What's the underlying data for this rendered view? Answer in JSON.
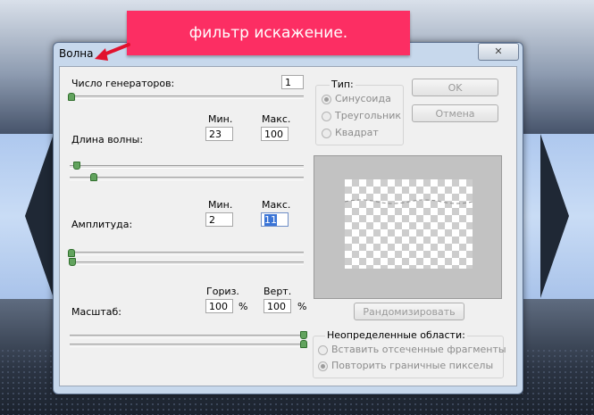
{
  "annotation": {
    "text": "фильтр искажение."
  },
  "dialog": {
    "title": "Волна",
    "close_label": "✕"
  },
  "generators": {
    "label": "Число генераторов:",
    "value": "1",
    "slider_fraction": 0.0
  },
  "wavelength": {
    "label": "Длина волны:",
    "min_label": "Мин.",
    "max_label": "Макс.",
    "min_value": "23",
    "max_value": "100"
  },
  "amplitude": {
    "label": "Амплитуда:",
    "min_label": "Мин.",
    "max_label": "Макс.",
    "min_value": "2",
    "max_value": "11"
  },
  "scale": {
    "label": "Масштаб:",
    "horiz_label": "Гориз.",
    "vert_label": "Верт.",
    "horiz_value": "100",
    "vert_value": "100",
    "unit": "%"
  },
  "type_group": {
    "title": "Тип:",
    "options": [
      {
        "label": "Синусоида",
        "selected": true
      },
      {
        "label": "Треугольник",
        "selected": false
      },
      {
        "label": "Квадрат",
        "selected": false
      }
    ]
  },
  "buttons": {
    "ok": "OK",
    "cancel": "Отмена",
    "randomize": "Рандомизировать"
  },
  "undefined_areas": {
    "title": "Неопределенные области:",
    "options": [
      {
        "label": "Вставить отсеченные фрагменты",
        "selected": false
      },
      {
        "label": "Повторить граничные пикселы",
        "selected": true
      }
    ]
  },
  "colors": {
    "accent": "#fc2e63",
    "slider_thumb": "#62a35e"
  }
}
